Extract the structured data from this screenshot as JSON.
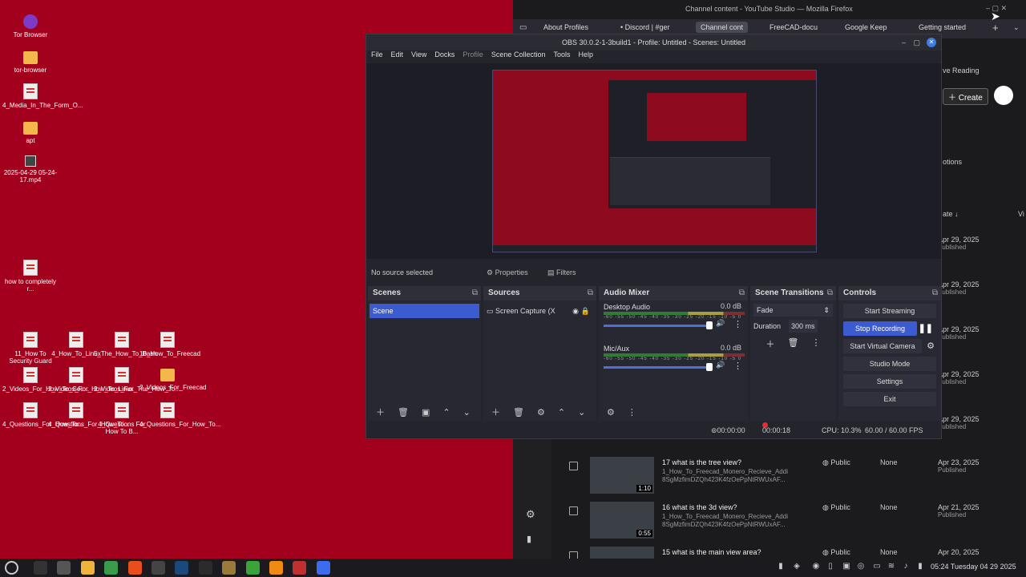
{
  "desktop": {
    "icons": [
      {
        "label": "Tor Browser",
        "kind": "tor"
      },
      {
        "label": "tor-browser",
        "kind": "folder"
      },
      {
        "label": "4_Media_In_The_Form_O...",
        "kind": "file"
      },
      {
        "label": "apt",
        "kind": "folder"
      },
      {
        "label": "2025-04-29 05-24-17.mp4",
        "kind": "video"
      },
      {
        "label": "how to completely r...",
        "kind": "file"
      },
      {
        "label": "11_How To Security Guard",
        "kind": "file"
      },
      {
        "label": "4_How_To_Linux",
        "kind": "file"
      },
      {
        "label": "5_The_How_To_Bash",
        "kind": "file"
      },
      {
        "label": "10_How_To_Freecad",
        "kind": "file"
      },
      {
        "label": "2_Videos_For_How_To_Sec...",
        "kind": "file"
      },
      {
        "label": "2_Videos_For_How_To_Linux",
        "kind": "file"
      },
      {
        "label": "2_Videos_For_The_How_To...",
        "kind": "file"
      },
      {
        "label": "2_Videos_For_Freecad",
        "kind": "folder"
      },
      {
        "label": "4_Questions_For_How_To...",
        "kind": "file"
      },
      {
        "label": "4_Questions_For_How_To...",
        "kind": "file"
      },
      {
        "label": "4_Questions For How To B...",
        "kind": "file"
      },
      {
        "label": "4_Questions_For_How_To...",
        "kind": "file"
      }
    ]
  },
  "firefox": {
    "title": "Channel content - YouTube Studio — Mozilla Firefox",
    "tabs": [
      "About Profiles",
      "• Discord | #ger",
      "Channel cont",
      "FreeCAD-docu",
      "Google Keep",
      "Getting started"
    ],
    "side_labels": {
      "reading": "ve Reading",
      "create": "Create",
      "options": "otions",
      "sort": "ate ↓",
      "view": "Vi"
    },
    "partial_dates": [
      {
        "date": "Apr 29, 2025",
        "status": "Published"
      },
      {
        "date": "Apr 29, 2025",
        "status": "Published"
      },
      {
        "date": "Apr 29, 2025",
        "status": "Published"
      },
      {
        "date": "Apr 29, 2025",
        "status": "Published"
      },
      {
        "date": "Apr 29, 2025",
        "status": "Published"
      }
    ],
    "videos": [
      {
        "title": "17 what is the tree view?",
        "desc": "1_How_To_Freecad_Monero_Recieve_Addi 8SgMzfimDZQh423K4fzOePpNtRWUxAF...",
        "duration": "1:10",
        "visibility": "Public",
        "restrictions": "None",
        "date": "Apr 23, 2025",
        "status": "Published"
      },
      {
        "title": "16 what is the 3d view?",
        "desc": "1_How_To_Freecad_Monero_Recieve_Addi 8SgMzfimDZQh423K4fzOePpNtRWUxAF...",
        "duration": "0:55",
        "visibility": "Public",
        "restrictions": "None",
        "date": "Apr 21, 2025",
        "status": "Published"
      },
      {
        "title": "15 what is the main view area?",
        "desc": "",
        "duration": "",
        "visibility": "Public",
        "restrictions": "None",
        "date": "Apr 20, 2025",
        "status": ""
      }
    ]
  },
  "obs": {
    "title": "OBS 30.0.2-1-3build1 - Profile: Untitled - Scenes: Untitled",
    "menu": [
      "File",
      "Edit",
      "View",
      "Docks",
      "Profile",
      "Scene Collection",
      "Tools",
      "Help"
    ],
    "no_source": "No source selected",
    "properties": "Properties",
    "filters": "Filters",
    "docks": {
      "scenes": {
        "title": "Scenes",
        "items": [
          "Scene"
        ]
      },
      "sources": {
        "title": "Sources",
        "items": [
          "Screen Capture (X"
        ]
      },
      "mixer": {
        "title": "Audio Mixer",
        "channels": [
          {
            "name": "Desktop Audio",
            "db": "0.0 dB"
          },
          {
            "name": "Mic/Aux",
            "db": "0.0 dB"
          }
        ],
        "scale": "-60 -55 -50 -45 -40 -35 -30 -25 -20 -15 -10 -5 0"
      },
      "transitions": {
        "title": "Scene Transitions",
        "transition": "Fade",
        "duration_label": "Duration",
        "duration_value": "300 ms"
      },
      "controls": {
        "title": "Controls",
        "buttons": [
          "Start Streaming",
          "Stop Recording",
          "Start Virtual Camera",
          "Studio Mode",
          "Settings",
          "Exit"
        ]
      }
    },
    "status": {
      "stream_time": "00:00:00",
      "rec_time": "00:00:18",
      "cpu": "CPU: 10.3%",
      "fps": "60.00 / 60.00 FPS"
    }
  },
  "taskbar": {
    "clock": "05:24 Tuesday 04 29 2025",
    "apps": [
      {
        "name": "terminal",
        "color": "#333"
      },
      {
        "name": "settings",
        "color": "#555"
      },
      {
        "name": "files",
        "color": "#f0b43c"
      },
      {
        "name": "chrome",
        "color": "#3a9b4c"
      },
      {
        "name": "brave",
        "color": "#e84d1c"
      },
      {
        "name": "obs",
        "color": "#444"
      },
      {
        "name": "steam",
        "color": "#1b4a7a"
      },
      {
        "name": "terminal2",
        "color": "#2b2b2b"
      },
      {
        "name": "gimp",
        "color": "#9a7a3a"
      },
      {
        "name": "app-green",
        "color": "#3aa33a"
      },
      {
        "name": "vlc",
        "color": "#f08a14"
      },
      {
        "name": "app-red",
        "color": "#c0302e"
      },
      {
        "name": "app-blue",
        "color": "#3b6cf0"
      }
    ]
  }
}
